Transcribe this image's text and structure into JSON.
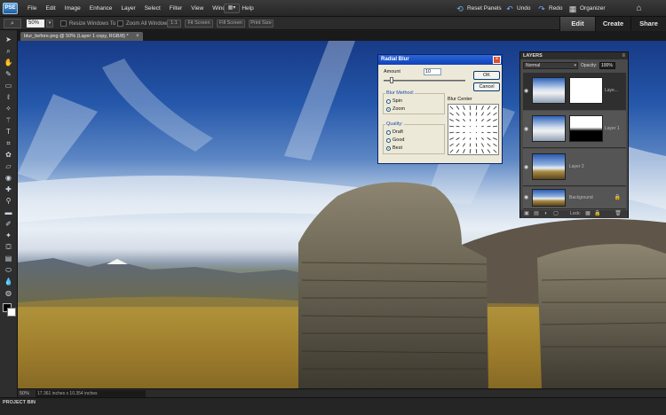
{
  "app": {
    "logo": "PSE"
  },
  "menu": [
    "File",
    "Edit",
    "Image",
    "Enhance",
    "Layer",
    "Select",
    "Filter",
    "View",
    "Window",
    "Help"
  ],
  "top_actions": {
    "reset_panels": "Reset Panels",
    "undo": "Undo",
    "redo": "Redo",
    "organizer": "Organizer"
  },
  "options_bar": {
    "zoom_value": "50%",
    "resize_windows": "Resize Windows To Fit",
    "zoom_all_windows": "Zoom All Windows",
    "actual_pixels": "1:1",
    "fit_screen": "Fit Screen",
    "fill_screen": "Fill Screen",
    "print_size": "Print Size"
  },
  "mode_tabs": [
    "Edit",
    "Create",
    "Share"
  ],
  "document": {
    "tab_title": "blur_before.png @ 50% (Layer 1 copy, RGB/8) *",
    "close": "×"
  },
  "status": {
    "zoom": "50%",
    "info": "17.361 inches x 10.354 inches"
  },
  "project_bin": "PROJECT BIN",
  "dialog": {
    "title": "Radial Blur",
    "close": "×",
    "amount_label": "Amount",
    "amount_value": "10",
    "amount_fraction": 0.1,
    "ok": "OK",
    "cancel": "Cancel",
    "blur_method_label": "Blur Method:",
    "methods": [
      "Spin",
      "Zoom"
    ],
    "selected_method": "Zoom",
    "quality_label": "Quality:",
    "qualities": [
      "Draft",
      "Good",
      "Best"
    ],
    "selected_quality": "Best",
    "blur_center_label": "Blur Center"
  },
  "layers": {
    "title": "LAYERS",
    "menu": "≡",
    "blend_mode": "Normal",
    "opacity_label": "Opacity:",
    "opacity_value": "100%",
    "lock_label": "Lock:",
    "rows": [
      {
        "name": "Laye...",
        "thumb": "sky",
        "mask": true,
        "selected": true
      },
      {
        "name": "Layer 1",
        "thumb": "sky",
        "mask": true,
        "selected": false
      },
      {
        "name": "Layer 2",
        "thumb": "img",
        "mask": false,
        "selected": false
      },
      {
        "name": "Background",
        "thumb": "img",
        "mask": false,
        "selected": false
      }
    ]
  },
  "colors": {
    "accent_blue": "#6fb0f0",
    "dialog_title": "#0f42b8",
    "panel_bg": "#4a4a4a"
  }
}
